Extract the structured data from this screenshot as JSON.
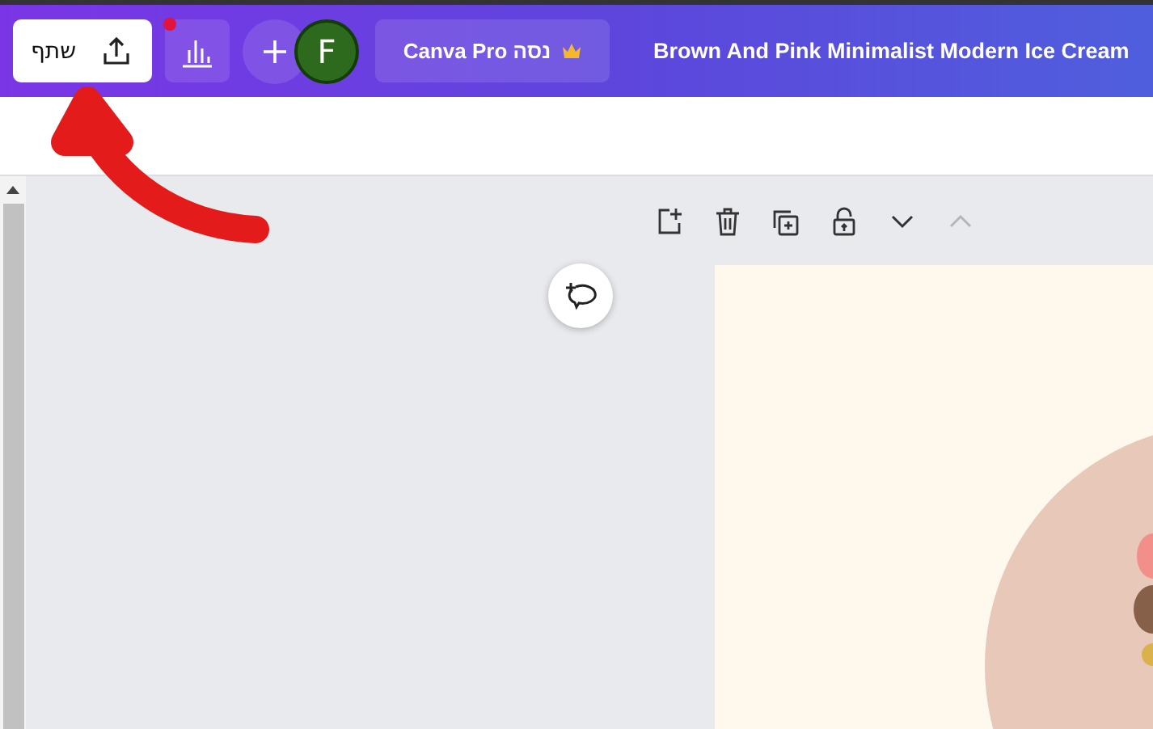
{
  "header": {
    "share_button": {
      "label": "שתף"
    },
    "stats_button": {
      "notification": true
    },
    "avatar": {
      "letter": "F"
    },
    "pro_button": {
      "label": "נסה Canva Pro"
    },
    "title": "Brown And Pink Minimalist Modern Ice Cream"
  },
  "page_toolbar": [
    {
      "kind": "add-page",
      "disabled": false
    },
    {
      "kind": "delete",
      "disabled": false
    },
    {
      "kind": "duplicate",
      "disabled": false
    },
    {
      "kind": "lock",
      "disabled": false
    },
    {
      "kind": "down",
      "disabled": false
    },
    {
      "kind": "up",
      "disabled": true
    }
  ]
}
